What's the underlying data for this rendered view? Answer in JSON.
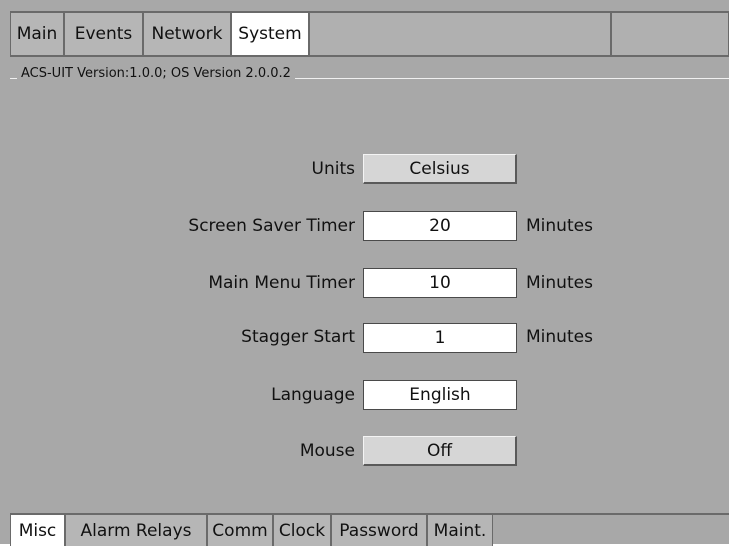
{
  "top_tabs": [
    {
      "label": "Main",
      "active": false
    },
    {
      "label": "Events",
      "active": false
    },
    {
      "label": "Network",
      "active": false
    },
    {
      "label": "System",
      "active": true
    }
  ],
  "version_caption": "ACS-UIT Version:1.0.0; OS Version  2.0.0.2",
  "settings": {
    "units": {
      "label": "Units",
      "value": "Celsius"
    },
    "screen_saver_timer": {
      "label": "Screen Saver Timer",
      "value": "20",
      "unit": "Minutes"
    },
    "main_menu_timer": {
      "label": "Main Menu Timer",
      "value": "10",
      "unit": "Minutes"
    },
    "stagger_start": {
      "label": "Stagger Start",
      "value": "1",
      "unit": "Minutes"
    },
    "language": {
      "label": "Language",
      "value": "English"
    },
    "mouse": {
      "label": "Mouse",
      "value": "Off"
    }
  },
  "bottom_tabs": [
    {
      "label": "Misc",
      "active": true
    },
    {
      "label": "Alarm Relays",
      "active": false
    },
    {
      "label": "Comm",
      "active": false
    },
    {
      "label": "Clock",
      "active": false
    },
    {
      "label": "Password",
      "active": false
    },
    {
      "label": "Maint.",
      "active": false
    }
  ],
  "colors": {
    "panel_bg": "#a8a8a8",
    "active_tab": "#ffffff",
    "inactive_tab": "#b6b6b6",
    "button_face": "#d6d6d6"
  }
}
